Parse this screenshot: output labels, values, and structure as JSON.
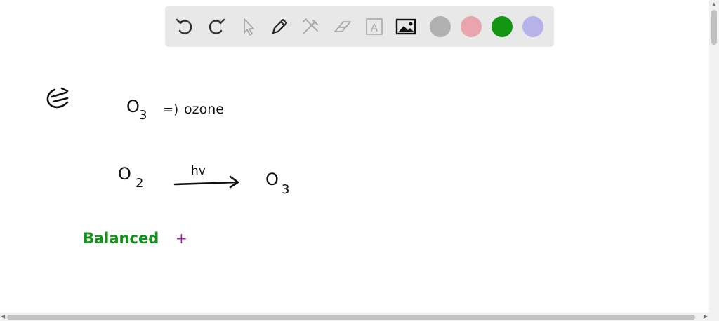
{
  "toolbar": {
    "tools": [
      {
        "name": "undo-icon"
      },
      {
        "name": "redo-icon"
      },
      {
        "name": "pointer-icon"
      },
      {
        "name": "pen-icon"
      },
      {
        "name": "tools-icon"
      },
      {
        "name": "eraser-icon"
      },
      {
        "name": "text-icon",
        "glyph": "A"
      },
      {
        "name": "image-icon"
      }
    ],
    "colors": [
      "#b0b0b0",
      "#e8a5ad",
      "#129512",
      "#b7b3ea"
    ],
    "selected_color": "#129512"
  },
  "canvas": {
    "line1_formula": "O",
    "line1_sub": "3",
    "line1_arrow": "=)",
    "line1_word": "ozone",
    "reaction_reactant": "O",
    "reaction_reactant_sub": "2",
    "reaction_condition": "hv",
    "reaction_product": "O",
    "reaction_product_sub": "3",
    "balanced_label": "Balanced",
    "plus_mark": "+",
    "ink_colors": {
      "black": "#111111",
      "green": "#13931a",
      "purple": "#a11ba8"
    }
  }
}
